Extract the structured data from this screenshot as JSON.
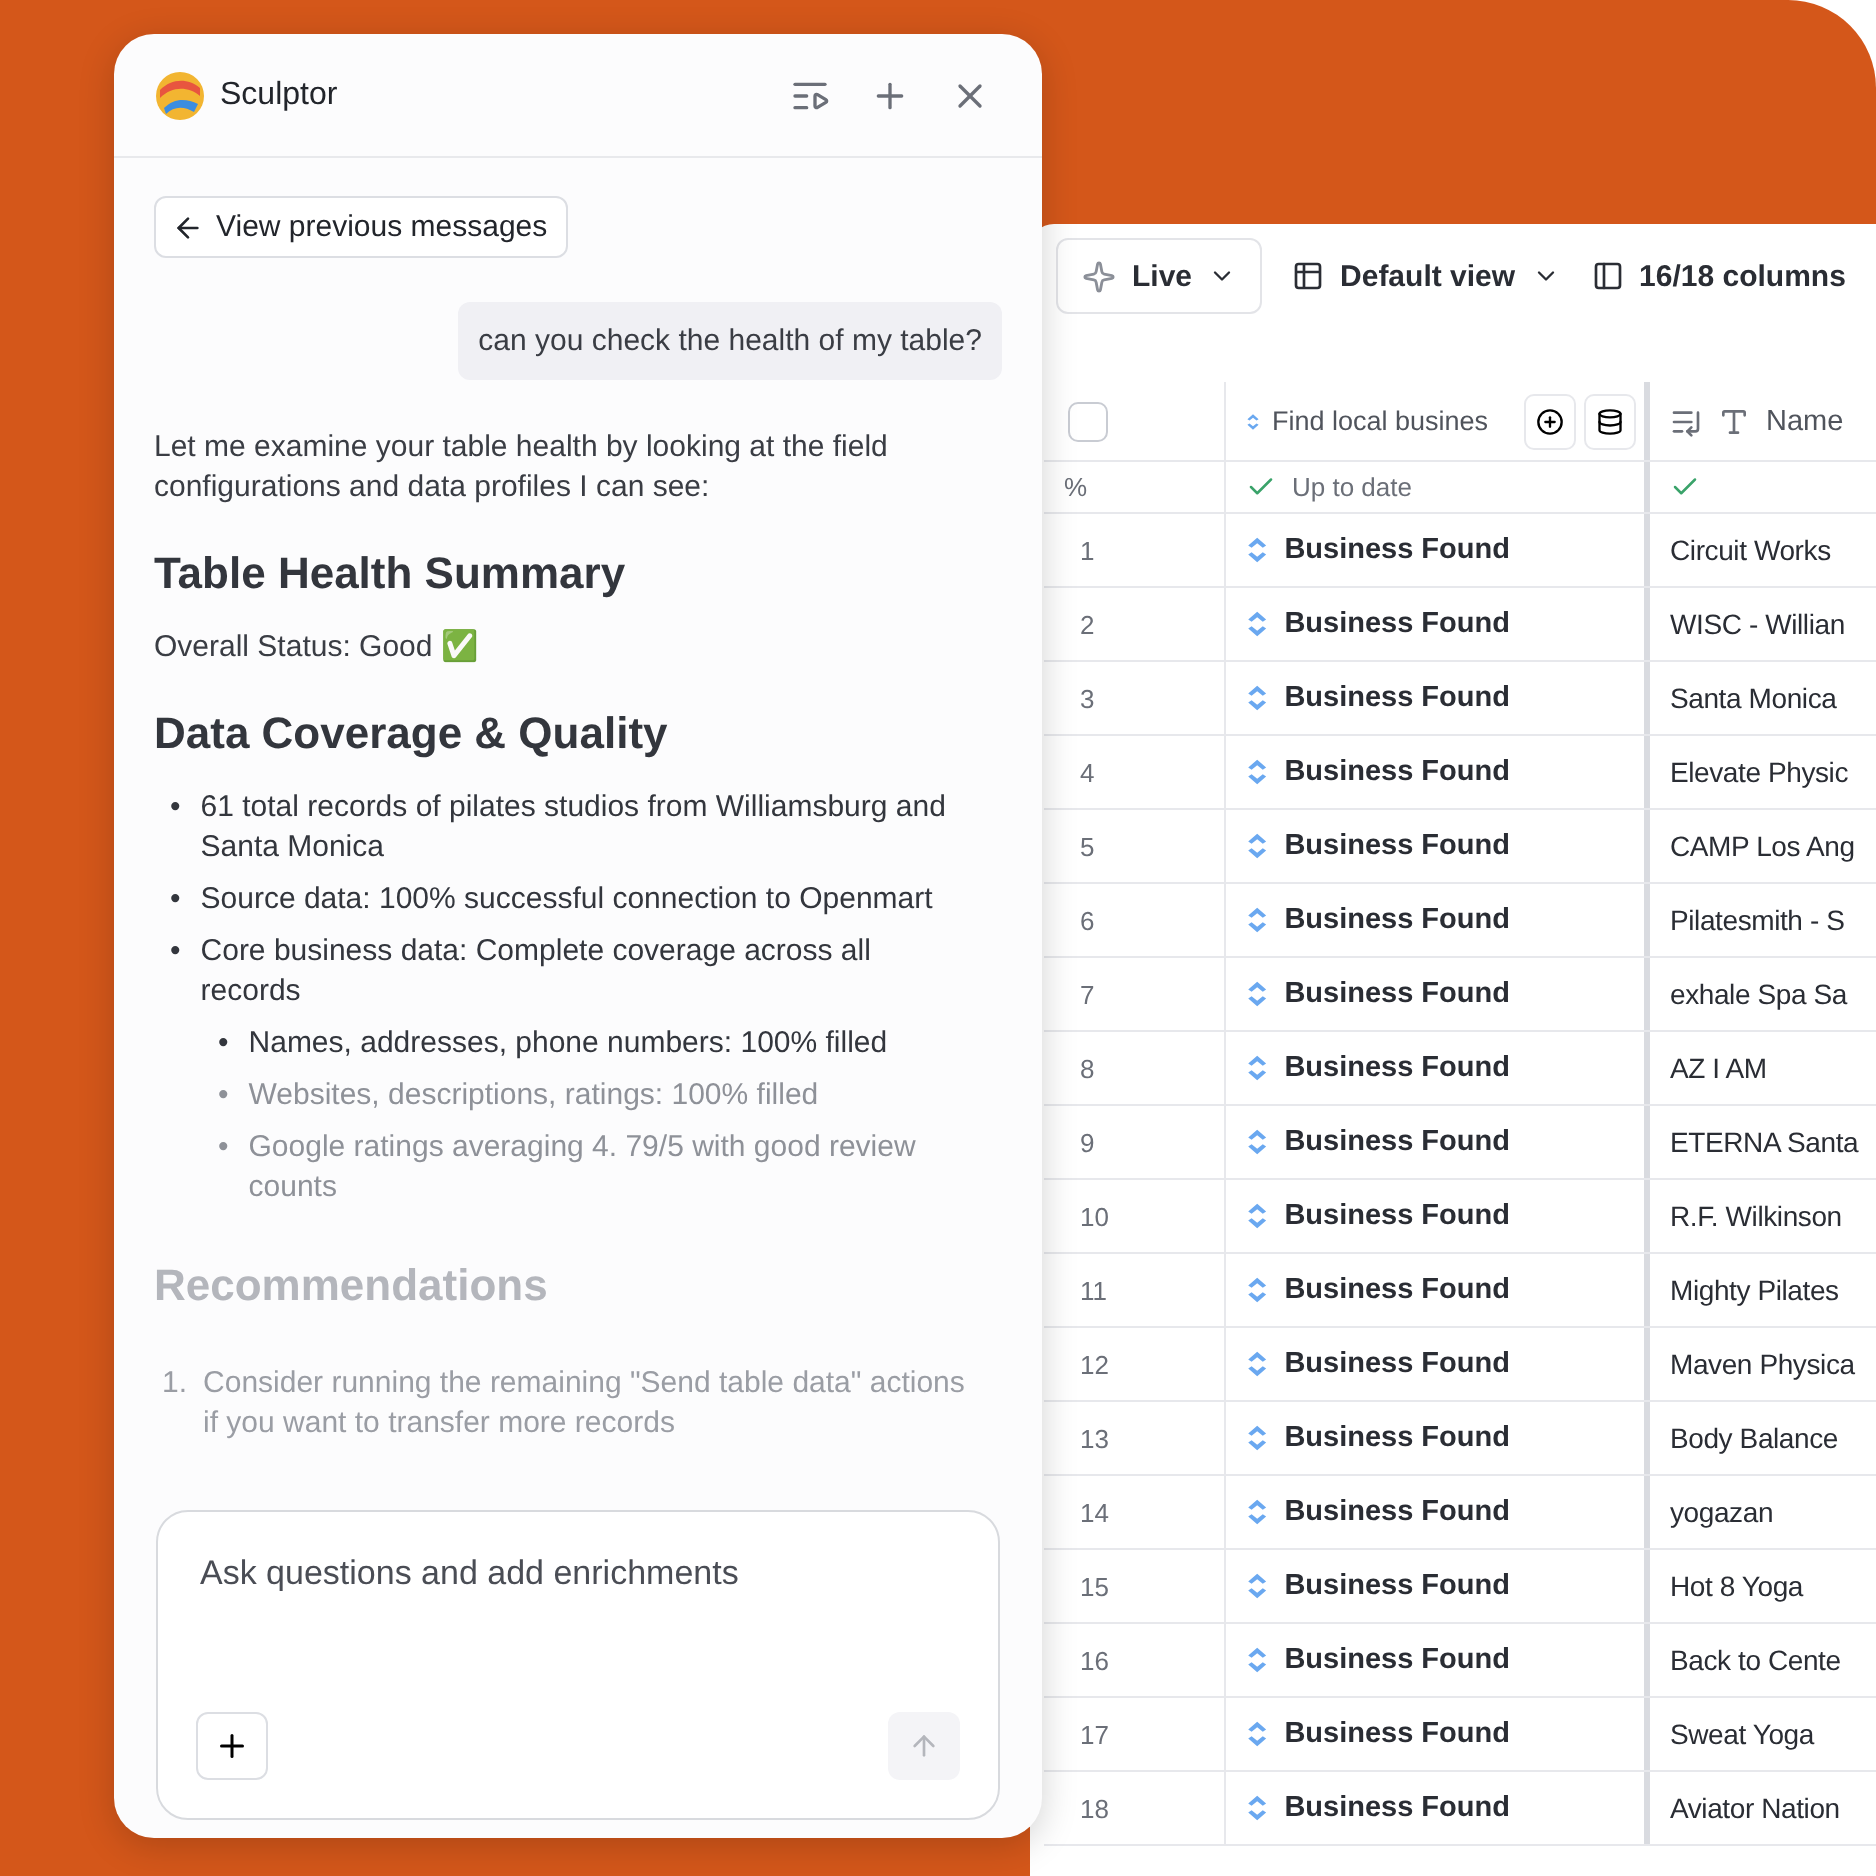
{
  "chat": {
    "title": "Sculptor",
    "back_button": "View previous messages",
    "user_message": "can you check the health of my table?",
    "intro": "Let me examine your table health by looking at the field configurations and data profiles I can see:",
    "sections": [
      {
        "heading": "Table Health Summary",
        "faded": false,
        "kind": "paragraph",
        "text": "Overall Status: Good ✅"
      },
      {
        "heading": "Data Coverage & Quality",
        "faded": false,
        "kind": "bullets",
        "items": [
          {
            "marker": "•",
            "text": "61 total records of pilates studios from Williamsburg and Santa Monica",
            "faded": false
          },
          {
            "marker": "•",
            "text": "Source data: 100% successful connection to Openmart",
            "faded": false
          },
          {
            "marker": "•",
            "text": "Core business data: Complete coverage across all records",
            "faded": false,
            "children": [
              {
                "marker": "•",
                "text": "Names, addresses, phone numbers: 100% filled",
                "faded": false
              },
              {
                "marker": "•",
                "text": "Websites, descriptions, ratings: 100% filled",
                "faded": true
              },
              {
                "marker": "•",
                "text": "Google ratings averaging 4. 79/5 with good review counts",
                "faded": true
              }
            ]
          }
        ]
      },
      {
        "heading": "Recommendations",
        "faded": true,
        "kind": "numbered",
        "items": [
          {
            "marker": "1.",
            "text": "Consider running the remaining \"Send table data\" actions if you want to transfer more records",
            "faded": true
          }
        ]
      }
    ],
    "input": {
      "placeholder": "Ask questions and add enrichments"
    }
  },
  "table": {
    "toolbar": [
      {
        "kind": "live",
        "label": "Live"
      },
      {
        "kind": "view",
        "label": "Default view"
      },
      {
        "kind": "columns",
        "label": "16/18 columns"
      }
    ],
    "columns": [
      {
        "kind": "select",
        "checked": false
      },
      {
        "kind": "enrich",
        "label": "Find local busines"
      },
      {
        "kind": "text",
        "label": "Name"
      }
    ],
    "status": {
      "row_label": "%",
      "column_1": "Up to date"
    },
    "rows": [
      {
        "n": "1",
        "status": "Business Found",
        "name": "Circuit Works"
      },
      {
        "n": "2",
        "status": "Business Found",
        "name": "WISC - Willian"
      },
      {
        "n": "3",
        "status": "Business Found",
        "name": "Santa Monica"
      },
      {
        "n": "4",
        "status": "Business Found",
        "name": "Elevate Physic"
      },
      {
        "n": "5",
        "status": "Business Found",
        "name": "CAMP Los Ang"
      },
      {
        "n": "6",
        "status": "Business Found",
        "name": "Pilatesmith - S"
      },
      {
        "n": "7",
        "status": "Business Found",
        "name": "exhale Spa Sa"
      },
      {
        "n": "8",
        "status": "Business Found",
        "name": "AZ I AM"
      },
      {
        "n": "9",
        "status": "Business Found",
        "name": "ETERNA Santa"
      },
      {
        "n": "10",
        "status": "Business Found",
        "name": "R.F. Wilkinson"
      },
      {
        "n": "11",
        "status": "Business Found",
        "name": "Mighty Pilates"
      },
      {
        "n": "12",
        "status": "Business Found",
        "name": "Maven Physica"
      },
      {
        "n": "13",
        "status": "Business Found",
        "name": "Body Balance"
      },
      {
        "n": "14",
        "status": "Business Found",
        "name": "yogazan"
      },
      {
        "n": "15",
        "status": "Business Found",
        "name": "Hot 8 Yoga"
      },
      {
        "n": "16",
        "status": "Business Found",
        "name": "Back to Cente"
      },
      {
        "n": "17",
        "status": "Business Found",
        "name": "Sweat Yoga"
      },
      {
        "n": "18",
        "status": "Business Found",
        "name": "Aviator Nation"
      }
    ]
  }
}
